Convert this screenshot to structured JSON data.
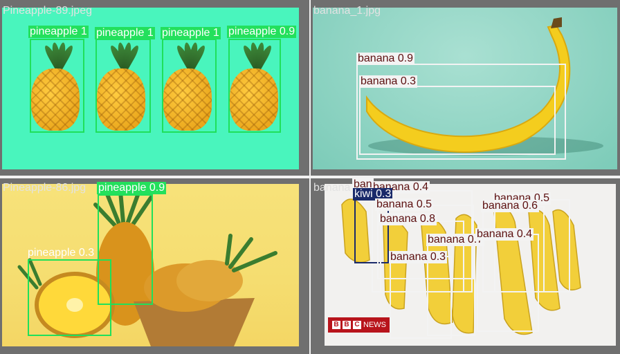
{
  "panels": [
    {
      "title": "Pineapple-89.jpeg",
      "labels": [
        "pineapple 1",
        "pineapple 1",
        "pineapple 1",
        "pineapple 0.9"
      ]
    },
    {
      "title": "banana_1.jpg",
      "labels": [
        "banana 0.9",
        "banana 0.3"
      ]
    },
    {
      "title": "Pineapple-86.jpg",
      "labels": [
        "pineapple 0.9",
        "pineapple 0.3"
      ]
    },
    {
      "title": "banana",
      "labels": [
        "ban",
        "banana 0.4",
        "kiwi 0.3",
        "banana 0.5",
        "banana 0.8",
        "banana 0.7",
        "banana 0.3",
        "banana 0.5",
        "banana 0.6",
        "banana 0.4"
      ],
      "watermark": "NEWS",
      "watermark_letters": [
        "B",
        "B",
        "C"
      ]
    }
  ],
  "colors": {
    "background": "#6f6f6f",
    "high_conf_box": "#1fe05a",
    "low_conf_box": "#f3f3f3",
    "kiwi_box": "#1a2a6a",
    "label_text_dark": "#5b0f0f"
  }
}
